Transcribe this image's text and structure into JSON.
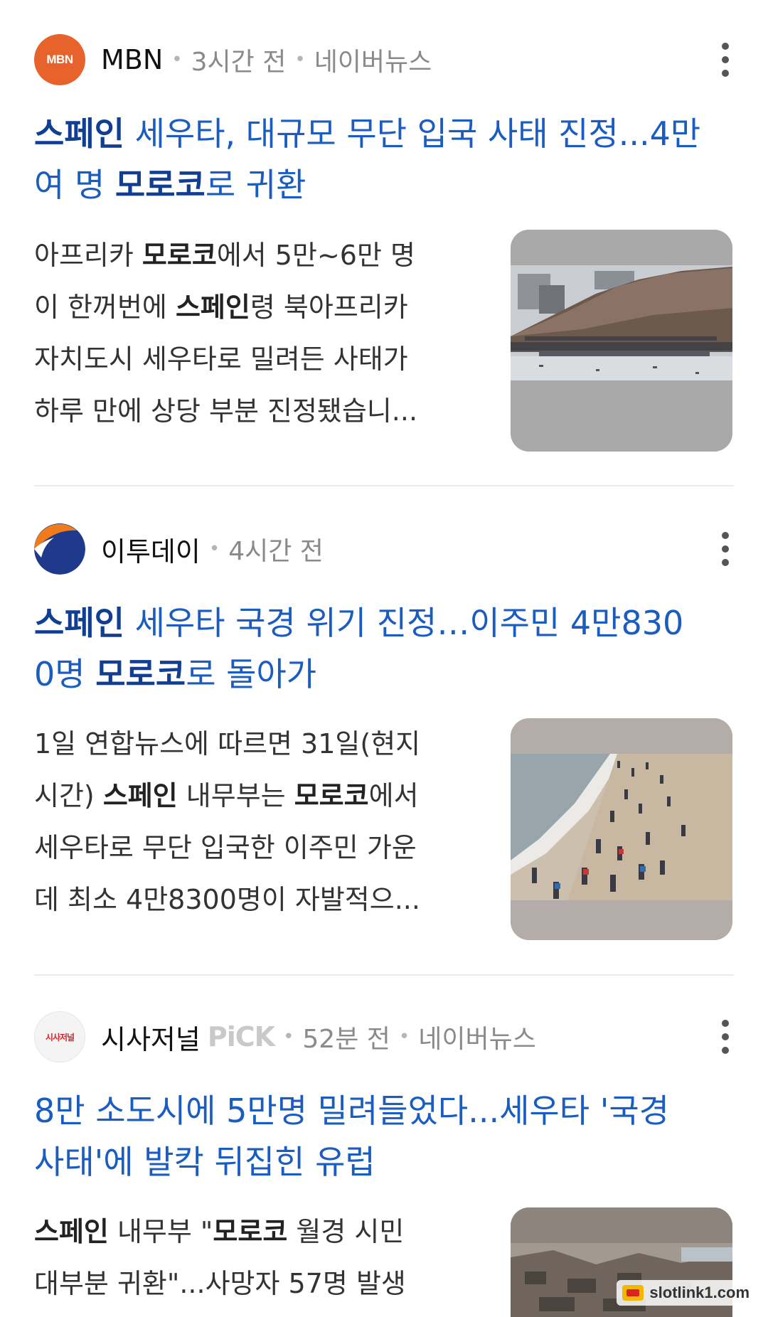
{
  "articles": [
    {
      "source": "MBN",
      "logo_text": "MBN",
      "logo_color": "#e8622c",
      "time": "3시간 전",
      "platform": "네이버뉴스",
      "title": [
        {
          "t": "스페인",
          "hl": true
        },
        {
          "t": " 세우타, 대규모 무단 입국 사태 진정...4만 여 명 ",
          "hl": false
        },
        {
          "t": "모로코",
          "hl": true
        },
        {
          "t": "로 귀환",
          "hl": false
        }
      ],
      "summary_lines": [
        [
          {
            "t": "아프리카 ",
            "hl": false
          },
          {
            "t": "모로코",
            "hl": true
          },
          {
            "t": "에서 5만~6만 명",
            "hl": false
          }
        ],
        [
          {
            "t": "이 한꺼번에 ",
            "hl": false
          },
          {
            "t": "스페인",
            "hl": true
          },
          {
            "t": "령 북아프리카",
            "hl": false
          }
        ],
        [
          {
            "t": "자치도시 세우타로 밀려든 사태가",
            "hl": false
          }
        ],
        [
          {
            "t": "하루 만에 상당 부분 진정됐습니...",
            "hl": false
          }
        ]
      ]
    },
    {
      "source": "이투데이",
      "logo_color": "#1f3a8a",
      "time": "4시간 전",
      "title": [
        {
          "t": "스페인",
          "hl": true
        },
        {
          "t": " 세우타 국경 위기 진정…이주민 4만830 0명 ",
          "hl": false
        },
        {
          "t": "모로코",
          "hl": true
        },
        {
          "t": "로 돌아가",
          "hl": false
        }
      ],
      "summary_lines": [
        [
          {
            "t": "1일 연합뉴스에 따르면 31일(현지",
            "hl": false
          }
        ],
        [
          {
            "t": "시간) ",
            "hl": false
          },
          {
            "t": "스페인",
            "hl": true
          },
          {
            "t": " 내무부는 ",
            "hl": false
          },
          {
            "t": "모로코",
            "hl": true
          },
          {
            "t": "에서",
            "hl": false
          }
        ],
        [
          {
            "t": "세우타로 무단 입국한 이주민 가운",
            "hl": false
          }
        ],
        [
          {
            "t": "데 최소 4만8300명이 자발적으...",
            "hl": false
          }
        ]
      ]
    },
    {
      "source": "시사저널",
      "logo_text": "시사저널",
      "logo_color": "#d6262b",
      "pick": "PiCK",
      "time": "52분 전",
      "platform": "네이버뉴스",
      "title": [
        {
          "t": "8만 소도시에 5만명 밀려들었다...세우타 '국경 사태'에 발칵 뒤집힌 유럽",
          "hl": false
        }
      ],
      "summary_lines": [
        [
          {
            "t": "스페인",
            "hl": true
          },
          {
            "t": " 내무부 \"",
            "hl": false
          },
          {
            "t": "모로코",
            "hl": true
          },
          {
            "t": " 월경 시민",
            "hl": false
          }
        ],
        [
          {
            "t": "대부분 귀환\"...사망자 57명 발생",
            "hl": false
          }
        ]
      ]
    }
  ],
  "watermark": "slotlink1.com"
}
